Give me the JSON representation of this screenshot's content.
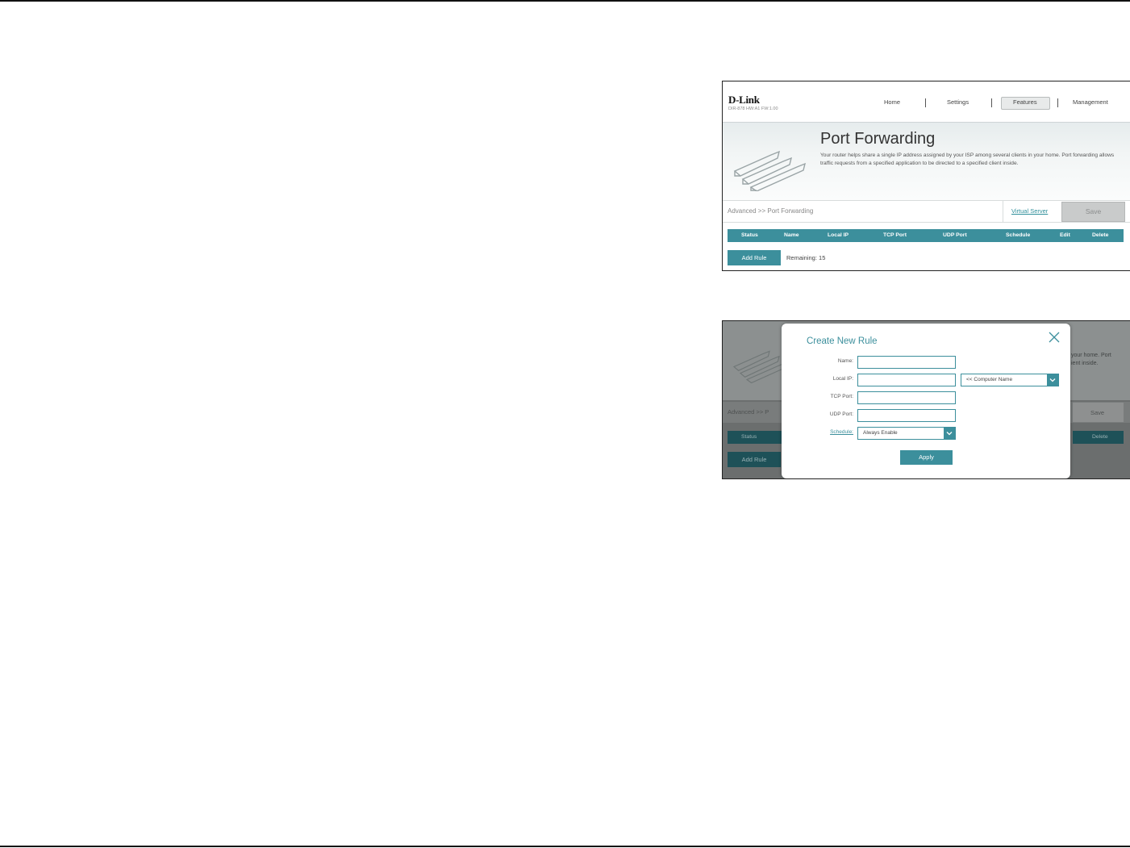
{
  "shot1": {
    "brand": "D-Link",
    "model": "DIR-878 HW:A1 FW:1.00",
    "nav": [
      "Home",
      "Settings",
      "Features",
      "Management"
    ],
    "active_nav": "Features",
    "title": "Port Forwarding",
    "description": "Your router helps share a single IP address assigned by your ISP among several clients in your home. Port forwarding allows traffic requests from a specified application to be directed to a specified client inside.",
    "breadcrumb": "Advanced >> Port Forwarding",
    "virtual_server_link": "Virtual Server",
    "save_label": "Save",
    "columns": [
      "Status",
      "Name",
      "Local IP",
      "TCP Port",
      "UDP Port",
      "Schedule",
      "Edit",
      "Delete"
    ],
    "add_rule_label": "Add Rule",
    "remaining": "Remaining: 15"
  },
  "shot2": {
    "modal_title": "Create New Rule",
    "fields": {
      "name_label": "Name:",
      "local_ip_label": "Local IP:",
      "tcp_port_label": "TCP Port:",
      "udp_port_label": "UDP Port:",
      "schedule_label": "Schedule:"
    },
    "computer_name_option": "<< Computer Name",
    "schedule_value": "Always Enable",
    "apply_label": "Apply",
    "bg_breadcrumb": "Advanced >> P",
    "bg_save": "Save",
    "bg_status": "Status",
    "bg_delete": "Delete",
    "bg_add_rule": "Add Rule",
    "bg_desc_line1": "your home. Port",
    "bg_desc_line2": "ient inside."
  }
}
